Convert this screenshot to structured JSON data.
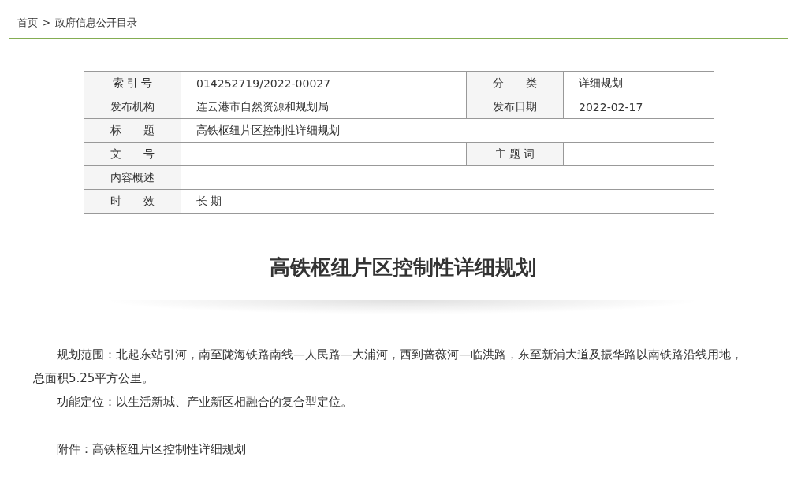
{
  "breadcrumb": {
    "items": [
      "首页",
      "政府信息公开目录"
    ],
    "separator": ">"
  },
  "info_table": [
    {
      "label": "索 引 号",
      "value": "014252719/2022-00027",
      "label2": "分　　类",
      "value2": "详细规划"
    },
    {
      "label": "发布机构",
      "value": "连云港市自然资源和规划局",
      "label2": "发布日期",
      "value2": "2022-02-17"
    },
    {
      "label": "标　　题",
      "value": "高铁枢纽片区控制性详细规划"
    },
    {
      "label": "文　　号",
      "label2": "主 题 词"
    },
    {
      "label": "内容概述"
    },
    {
      "label": "时　　效",
      "value": "长 期"
    }
  ],
  "article": {
    "title": "高铁枢纽片区控制性详细规划",
    "paragraphs": [
      "规划范围：北起东站引河，南至陇海铁路南线—人民路—大浦河，西到蔷薇河—临洪路，东至新浦大道及振华路以南铁路沿线用地，总面积5.25平方公里。",
      "功能定位：以生活新城、产业新区相融合的复合型定位。"
    ],
    "attachment": "附件：高铁枢纽片区控制性详细规划"
  }
}
